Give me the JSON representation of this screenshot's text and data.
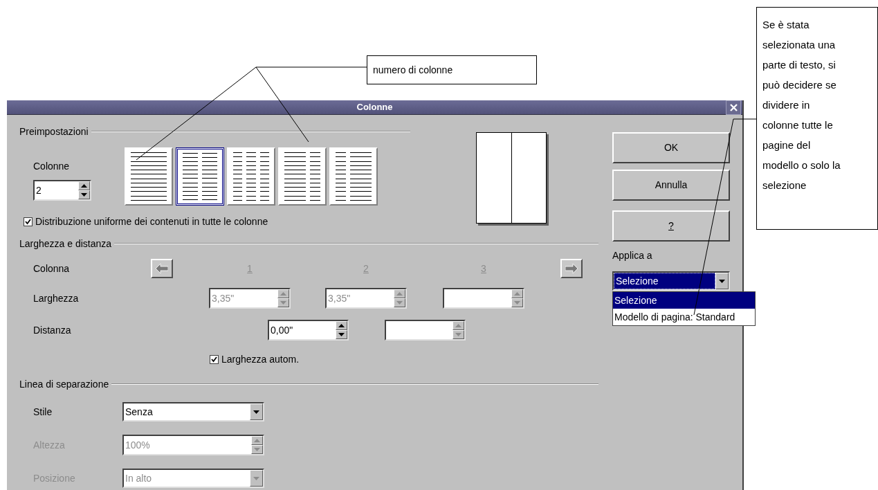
{
  "dialog": {
    "title": "Colonne"
  },
  "presets": {
    "title": "Preimpostazioni",
    "columns_label": "Colonne",
    "columns_value": "2",
    "layouts": [
      {
        "kind": "one",
        "selected": false
      },
      {
        "kind": "two",
        "selected": true
      },
      {
        "kind": "three",
        "selected": false
      },
      {
        "kind": "left-wide",
        "selected": false
      },
      {
        "kind": "right-wide",
        "selected": false
      }
    ]
  },
  "even_distribution": {
    "label": "Distribuzione uniforme dei contenuti in tutte le colonne",
    "checked": true
  },
  "width_spacing": {
    "title": "Larghezza e distanza",
    "column_label": "Colonna",
    "column_numbers": [
      "1",
      "2",
      "3"
    ],
    "width_label": "Larghezza",
    "widths": [
      {
        "value": "3,35\"",
        "disabled": true
      },
      {
        "value": "3,35\"",
        "disabled": true
      },
      {
        "disabled": true
      }
    ],
    "spacing_label": "Distanza",
    "spacings": [
      {
        "value": "0,00\"",
        "disabled": false
      },
      {
        "disabled": true
      }
    ]
  },
  "auto_width": {
    "label": "Larghezza autom.",
    "checked": true
  },
  "separator": {
    "title": "Linea di separazione",
    "fields": [
      {
        "kind": "select",
        "label": "Stile",
        "value": "Senza",
        "disabled": false
      },
      {
        "kind": "spin",
        "label": "Altezza",
        "value": "100%",
        "disabled": true
      },
      {
        "kind": "select",
        "label": "Posizione",
        "value": "In alto",
        "disabled": true
      }
    ]
  },
  "buttons": [
    "OK",
    "Annulla",
    "?"
  ],
  "apply_to": {
    "label": "Applica a",
    "value": "Selezione",
    "expanded": true,
    "options": [
      {
        "label": "Selezione",
        "selected": true
      },
      {
        "label": "Modello di pagina: Standard",
        "selected": false
      }
    ]
  },
  "annotations": [
    {
      "lines": [
        "numero di colonne"
      ]
    },
    {
      "lines": [
        "Se è stata",
        "selezionata una",
        "parte di testo, si",
        "può decidere se",
        "dividere in",
        "colonne tutte le",
        "pagine del",
        "modello o solo la",
        "selezione"
      ]
    }
  ]
}
